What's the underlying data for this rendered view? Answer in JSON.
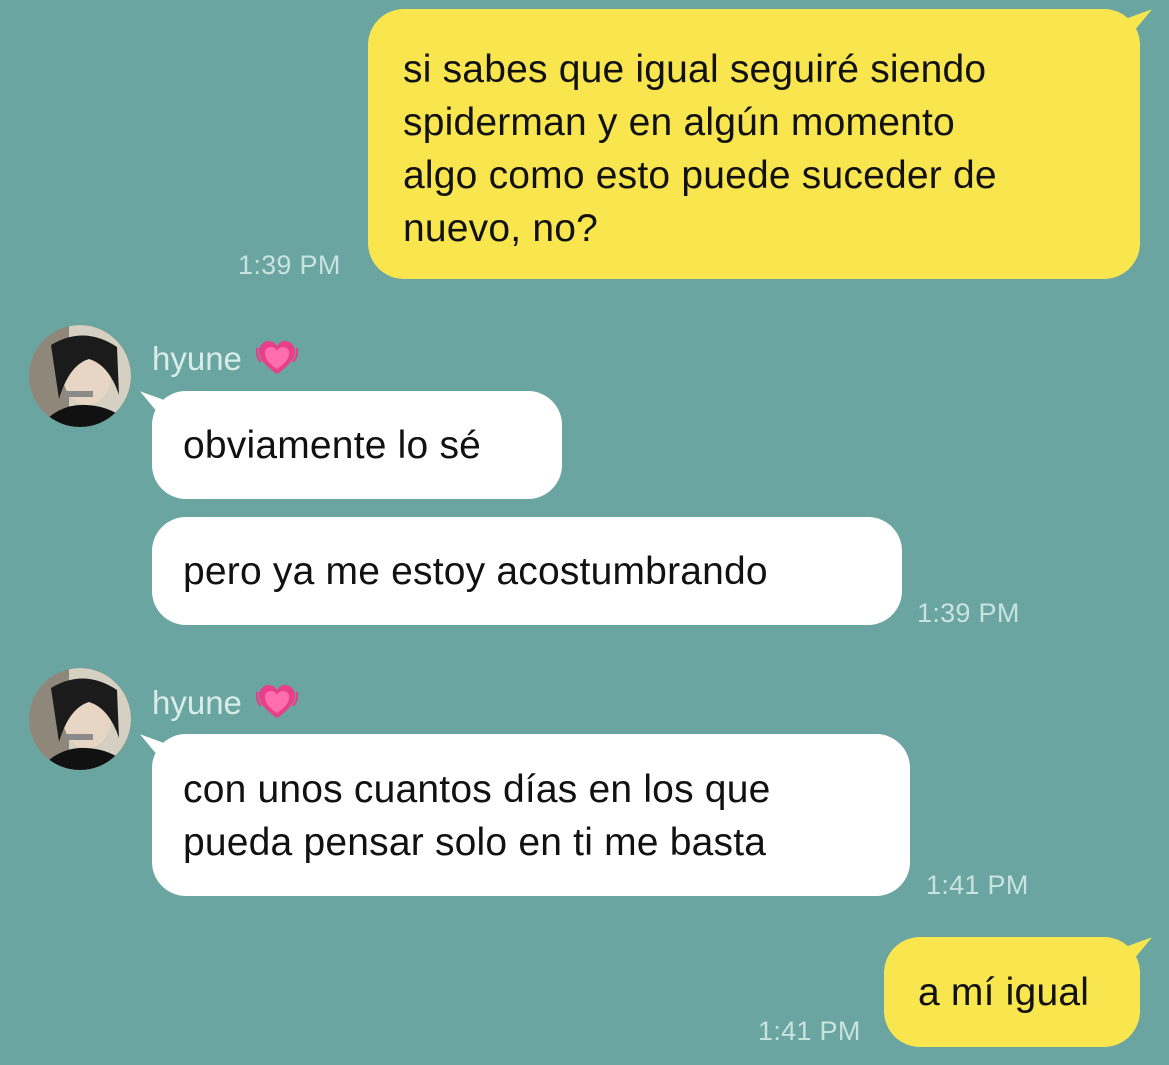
{
  "colors": {
    "background": "#6aa5a1",
    "outgoing_bubble": "#f9e64f",
    "incoming_bubble": "#ffffff",
    "timestamp": "#c9e3df"
  },
  "messages": [
    {
      "direction": "outgoing",
      "text": "si sabes que igual seguiré siendo\nspiderman y en algún momento\nalgo como esto puede suceder de\nnuevo, no?",
      "time": "1:39 PM"
    },
    {
      "direction": "incoming",
      "sender": "hyune",
      "sender_icon": "growing-heart-icon",
      "texts": [
        "obviamente lo sé",
        "pero ya me estoy acostumbrando"
      ],
      "time": "1:39 PM"
    },
    {
      "direction": "incoming",
      "sender": "hyune",
      "sender_icon": "growing-heart-icon",
      "texts": [
        "con unos cuantos días en los que\npueda pensar solo en ti me basta"
      ],
      "time": "1:41 PM"
    },
    {
      "direction": "outgoing",
      "text": "a mí igual",
      "time": "1:41 PM"
    }
  ]
}
